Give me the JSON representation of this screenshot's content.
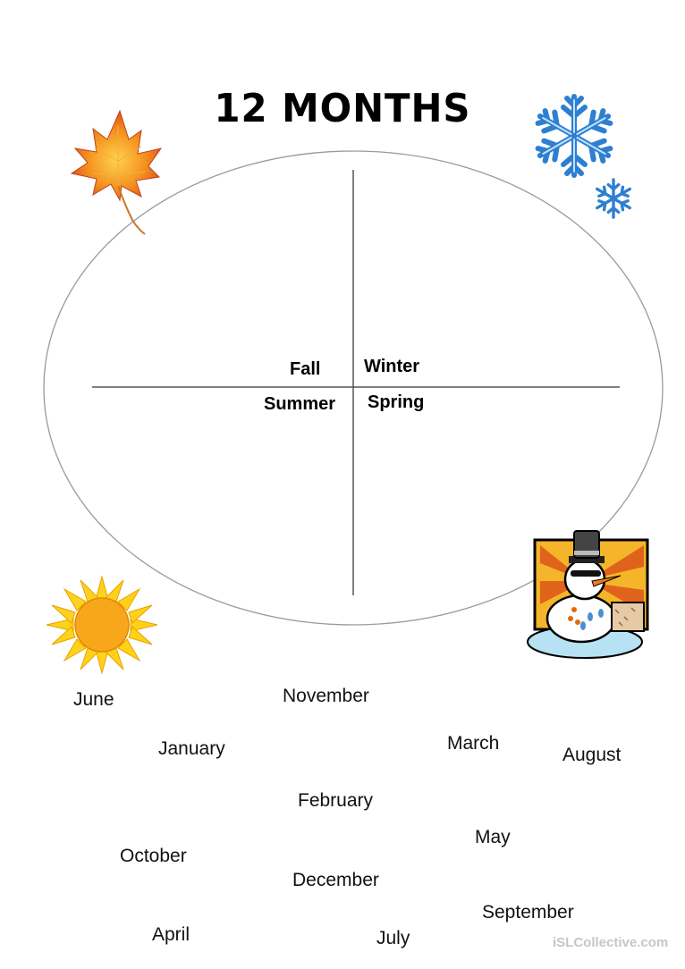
{
  "worksheet": {
    "title": "12 MONTHS",
    "seasons": {
      "fall": "Fall",
      "winter": "Winter",
      "summer": "Summer",
      "spring": "Spring"
    },
    "months": [
      "June",
      "November",
      "January",
      "March",
      "August",
      "February",
      "May",
      "October",
      "December",
      "September",
      "April",
      "July"
    ],
    "watermark": "iSLCollective.com"
  }
}
